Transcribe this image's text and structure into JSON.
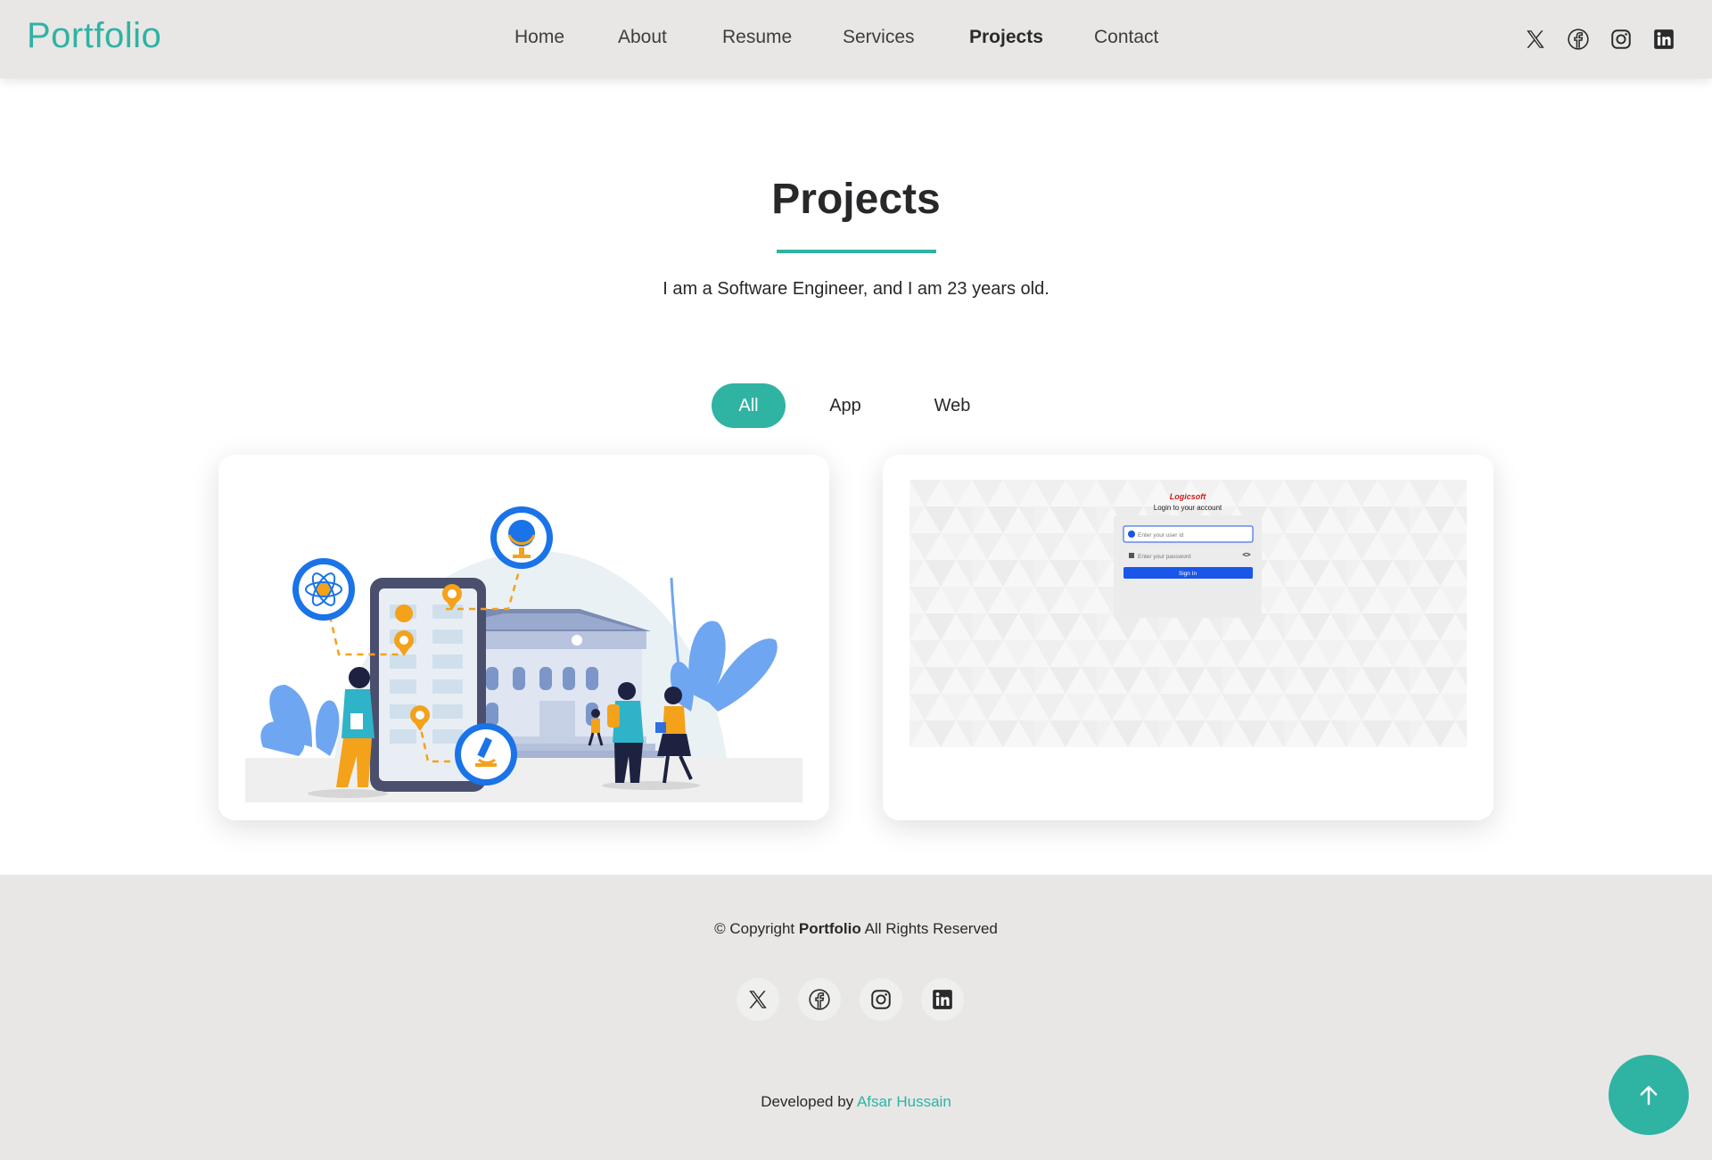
{
  "header": {
    "logo": "Portfolio",
    "nav": [
      "Home",
      "About",
      "Resume",
      "Services",
      "Projects",
      "Contact"
    ],
    "active_nav": "Projects",
    "social_icons": [
      "x-icon",
      "facebook-icon",
      "instagram-icon",
      "linkedin-icon"
    ]
  },
  "section": {
    "title": "Projects",
    "subtitle": "I am a Software Engineer, and I am 23 years old."
  },
  "filters": {
    "items": [
      "All",
      "App",
      "Web"
    ],
    "active": "All"
  },
  "cards": [
    {
      "image": "education-app-illustration"
    },
    {
      "image": "login-screen-screenshot",
      "brand": "Logicsoft",
      "heading": "Login to your account",
      "userid_placeholder": "Enter your user id",
      "password_placeholder": "Enter your password",
      "signin_label": "Sign In"
    }
  ],
  "footer": {
    "copyright_prefix": "© Copyright",
    "copyright_brand": "Portfolio",
    "copyright_suffix": "All Rights Reserved",
    "developed_by": "Developed by",
    "developer": "Afsar Hussain",
    "social_icons": [
      "x-icon",
      "facebook-icon",
      "instagram-icon",
      "linkedin-icon"
    ]
  },
  "colors": {
    "accent": "#2fb3a2",
    "header_bg": "#e8e7e6",
    "text": "#272829"
  }
}
